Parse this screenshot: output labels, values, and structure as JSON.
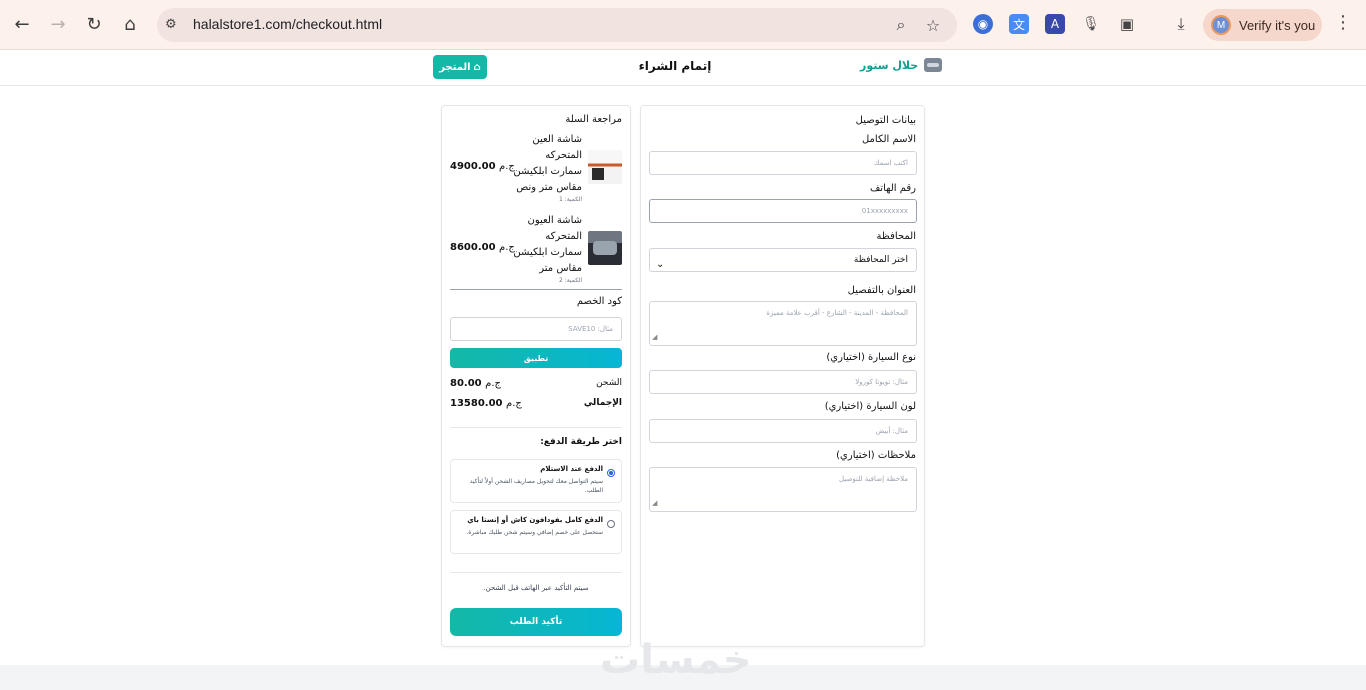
{
  "browser": {
    "url": "halalstore1.com/checkout.html",
    "profile_label": "Verify it's you",
    "profile_initial": "M"
  },
  "header": {
    "brand_name": "حلال ستور",
    "page_title": "إتمام الشراء",
    "store_button": "المتجر",
    "accent_color": "#14b8a6"
  },
  "delivery": {
    "title": "بيانات التوصيل",
    "fields": [
      {
        "label": "الاسم الكامل",
        "placeholder": "اكتب اسمك"
      },
      {
        "label": "رقم الهاتف",
        "placeholder": "01xxxxxxxxx"
      },
      {
        "label": "المحافظة",
        "value": "اختر المحافظة"
      },
      {
        "label": "العنوان بالتفصيل",
        "placeholder": "المحافظة - المدينة - الشارع - أقرب علامة مميزة"
      },
      {
        "label": "نوع السيارة (اختياري)",
        "placeholder": "مثال: تويوتا كورولا"
      },
      {
        "label": "لون السيارة (اختياري)",
        "placeholder": "مثال: أبيض"
      },
      {
        "label": "ملاحظات (اختياري)",
        "placeholder": "ملاحظة إضافية للتوصيل"
      }
    ]
  },
  "cart": {
    "title": "مراجعة السلة",
    "items": [
      {
        "name": "شاشة العين المتحركه سمارت ابلكيشن مقاس متر ونص",
        "qty": "الكمية: 1",
        "price": "4900.00",
        "currency": "ج.م"
      },
      {
        "name": "شاشة العيون المتحركه سمارت ابلكيشن مقاس متر",
        "qty": "الكمية: 2",
        "price": "8600.00",
        "currency": "ج.م"
      }
    ],
    "discount_label": "كود الخصم",
    "discount_placeholder": "مثال: SAVE10",
    "apply_button": "تطبيق",
    "shipping_label": "الشحن",
    "shipping_value": "80.00",
    "total_label": "الإجمالي",
    "total_value": "13580.00",
    "currency": "ج.م",
    "payment_title": "اختر طريقة الدفع:",
    "payment_options": [
      {
        "title": "الدفع عند الاستلام",
        "desc": "سيتم التواصل معك لتحويل مصاريف الشحن أولاً لتأكيد الطلب.",
        "selected": true
      },
      {
        "title": "الدفع كامل بفودافون كاش أو إنستا باي",
        "desc": "ستحصل على خصم إضافي وسيتم شحن طلبك مباشرة.",
        "selected": false
      }
    ],
    "confirm_note": "سيتم التأكيد عبر الهاتف قبل الشحن.",
    "confirm_button": "تأكيد الطلب"
  },
  "watermark": "خمسات"
}
